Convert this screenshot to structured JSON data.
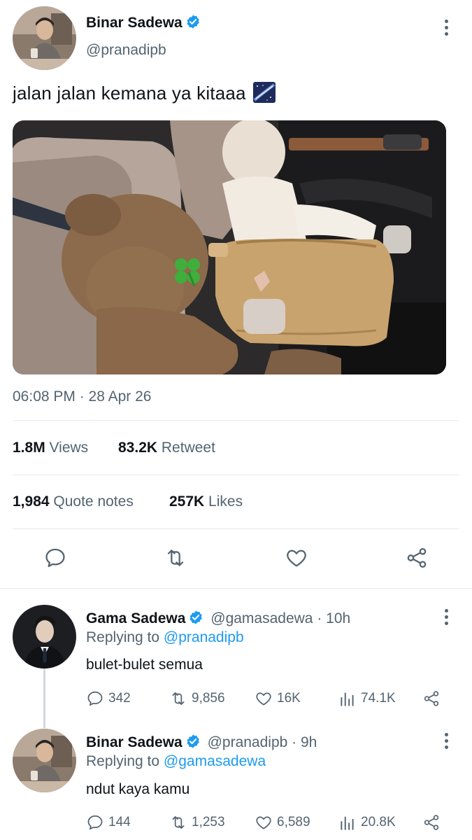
{
  "main_tweet": {
    "author_name": "Binar Sadewa",
    "author_handle": "@pranadipb",
    "verified": true,
    "text": "jalan jalan kemana ya kitaaa",
    "emoji_icon": "milky-way-icon",
    "timestamp": "06:08 PM · 28 Apr 26",
    "stats": {
      "views_value": "1.8M",
      "views_label": "Views",
      "retweets_value": "83.2K",
      "retweets_label": "Retweet",
      "quotes_value": "1,984",
      "quotes_label": "Quote notes",
      "likes_value": "257K",
      "likes_label": "Likes"
    },
    "actions": [
      "reply-icon",
      "retweet-icon",
      "like-icon",
      "share-icon"
    ]
  },
  "replies": [
    {
      "author_name": "Gama Sadewa",
      "author_handle": "@gamasadewa",
      "time": "· 10h",
      "replying_label": "Replying to",
      "replying_to": "@pranadipb",
      "text": "bulet-bulet semua",
      "reply_count": "342",
      "retweet_count": "9,856",
      "like_count": "16K",
      "view_count": "74.1K"
    },
    {
      "author_name": "Binar Sadewa",
      "author_handle": "@pranadipb",
      "time": "· 9h",
      "replying_label": "Replying to",
      "replying_to": "@gamasadewa",
      "text": "ndut kaya kamu",
      "reply_count": "144",
      "retweet_count": "1,253",
      "like_count": "6,589",
      "view_count": "20.8K"
    }
  ],
  "colors": {
    "verified_blue": "#1d9bf0",
    "secondary_text": "#536471",
    "primary_text": "#0f1419"
  }
}
